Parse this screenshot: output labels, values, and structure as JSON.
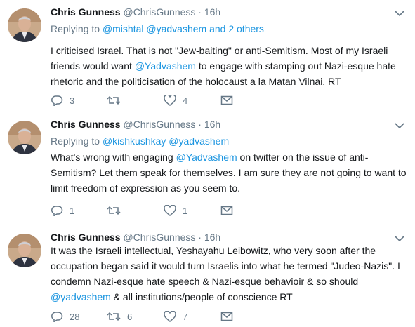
{
  "tweets": [
    {
      "name": "Chris Gunness",
      "handle": "@ChrisGunness",
      "time": "16h",
      "replying_prefix": "Replying to",
      "replying_mentions": [
        "@mishtal",
        "@yadvashem"
      ],
      "replying_suffix": "and 2 others",
      "lines": [
        "I criticised Israel. That is not \"Jew-baiting\" or anti-Semitism. Most of my Israeli",
        [
          "friends would want ",
          "@Yadvashem",
          " to engage with stamping out Nazi-esque hate"
        ],
        "rhetoric and the politicisation of the holocaust a la Matan Vilnai. RT"
      ],
      "replies": "3",
      "retweets": "",
      "likes": "4"
    },
    {
      "name": "Chris Gunness",
      "handle": "@ChrisGunness",
      "time": "16h",
      "replying_prefix": "Replying to",
      "replying_mentions": [
        "@kishkushkay",
        "@yadvashem"
      ],
      "replying_suffix": "",
      "lines": [
        [
          "What's wrong with engaging ",
          "@Yadvashem",
          " on twitter on the issue of anti-"
        ],
        "Semitism? Let them speak for themselves. I am sure they are not going to want to",
        "limit freedom of expression as you seem to."
      ],
      "replies": "1",
      "retweets": "",
      "likes": "1"
    },
    {
      "name": "Chris Gunness",
      "handle": "@ChrisGunness",
      "time": "16h",
      "lines": [
        "It was the Israeli intellectual, Yeshayahu Leibowitz, who very soon after the",
        "occupation began said it would turn Israelis into what he termed \"Judeo-Nazis\".  I",
        "condemn Nazi-esque hate speech & Nazi-esque behavioir & so should",
        [
          "",
          "@yadvashem",
          " & all institutions/people of conscience RT"
        ]
      ],
      "replies": "28",
      "retweets": "6",
      "likes": "7"
    }
  ],
  "icons": [
    "caret-down-icon",
    "reply-icon",
    "retweet-icon",
    "heart-icon",
    "message-icon"
  ],
  "colors": {
    "text": "#14171a",
    "muted": "#657786",
    "link": "#1b95e0",
    "border": "#e6ecf0"
  }
}
